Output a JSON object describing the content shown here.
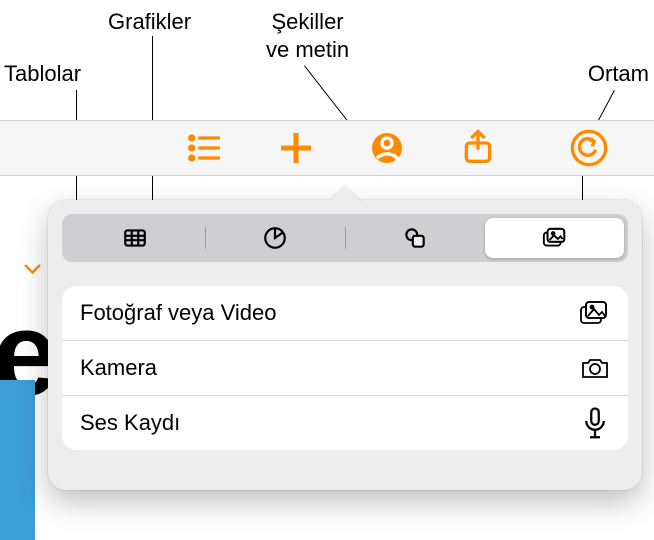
{
  "callouts": {
    "tables": "Tablolar",
    "charts": "Grafikler",
    "shapes_text": "Şekiller\nve metin",
    "media": "Ortam"
  },
  "toolbar": {
    "accent_color": "#ff8a00"
  },
  "popover": {
    "tabs": {
      "tables": "tables",
      "charts": "charts",
      "shapes": "shapes",
      "media": "media",
      "active": "media"
    },
    "options": {
      "photo_video": "Fotoğraf veya Video",
      "camera": "Kamera",
      "audio_recording": "Ses Kaydı"
    }
  }
}
